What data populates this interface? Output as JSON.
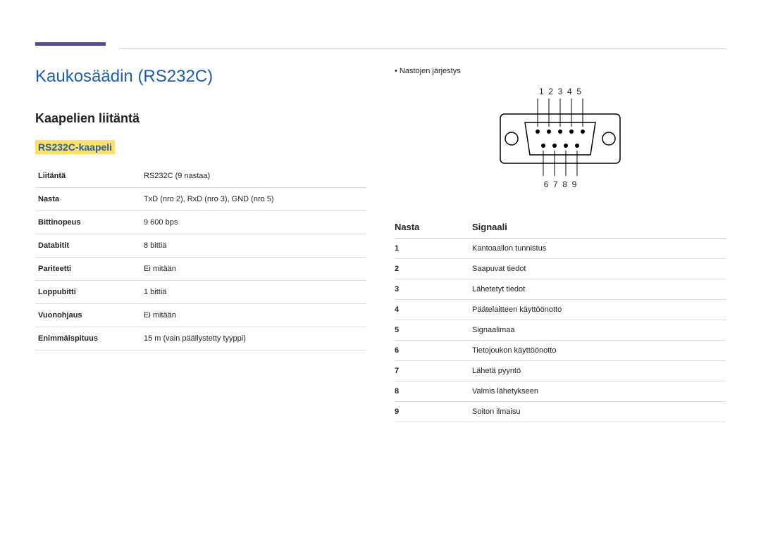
{
  "title": "Kaukosäädin (RS232C)",
  "subtitle": "Kaapelien liitäntä",
  "cable_heading": "RS232C-kaapeli",
  "spec_rows": [
    {
      "label": "Liitäntä",
      "value": "RS232C (9 nastaa)"
    },
    {
      "label": "Nasta",
      "value": "TxD (nro 2), RxD (nro 3), GND (nro 5)"
    },
    {
      "label": "Bittinopeus",
      "value": "9 600 bps"
    },
    {
      "label": "Databitit",
      "value": "8 bittiä"
    },
    {
      "label": "Pariteetti",
      "value": "Ei mitään"
    },
    {
      "label": "Loppubitti",
      "value": "1 bittiä"
    },
    {
      "label": "Vuonohjaus",
      "value": "Ei mitään"
    },
    {
      "label": "Enimmäispituus",
      "value": "15 m (vain päällystetty tyyppi)"
    }
  ],
  "pin_order_label": "Nastojen järjestys",
  "pin_numbers_top": "1  2  3  4  5",
  "pin_numbers_bottom": "6  7  8  9",
  "pin_header_col1": "Nasta",
  "pin_header_col2": "Signaali",
  "pin_rows": [
    {
      "n": "1",
      "sig": "Kantoaallon tunnistus"
    },
    {
      "n": "2",
      "sig": "Saapuvat tiedot"
    },
    {
      "n": "3",
      "sig": "Lähetetyt tiedot"
    },
    {
      "n": "4",
      "sig": "Päätelaitteen käyttöönotto"
    },
    {
      "n": "5",
      "sig": "Signaalimaa"
    },
    {
      "n": "6",
      "sig": "Tietojoukon käyttöönotto"
    },
    {
      "n": "7",
      "sig": "Lähetä pyyntö"
    },
    {
      "n": "8",
      "sig": "Valmis lähetykseen"
    },
    {
      "n": "9",
      "sig": "Soiton ilmaisu"
    }
  ]
}
